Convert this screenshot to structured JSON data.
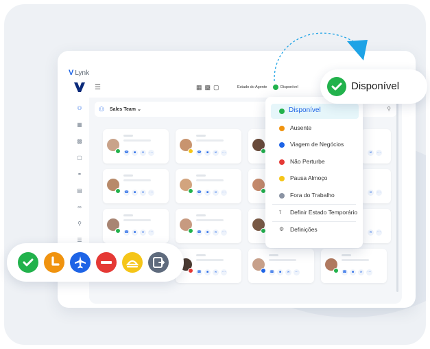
{
  "app": {
    "brand_mark": "V",
    "brand_name": "Lynk"
  },
  "topbar": {
    "agent_status_label": "Estado do Agente",
    "agent_status_value": "Disponível",
    "status_color": "#22b24c"
  },
  "team": {
    "name": "Sales Team"
  },
  "dropdown": {
    "items": [
      {
        "label": "Disponível",
        "color": "#22b24c",
        "icon": "check-icon",
        "active": true
      },
      {
        "label": "Ausente",
        "color": "#f0930f",
        "icon": "clock-icon"
      },
      {
        "label": "Viagem de Negócios",
        "color": "#1e64e6",
        "icon": "plane-icon"
      },
      {
        "label": "Não Perturbe",
        "color": "#e53935",
        "icon": "minus-icon"
      },
      {
        "label": "Pausa Almoço",
        "color": "#f5c518",
        "icon": "lunch-icon"
      },
      {
        "label": "Fora do Trabalho",
        "color": "#8a93a3",
        "icon": "exit-icon"
      }
    ],
    "actions": [
      {
        "label": "Definir Estado Temporário",
        "icon": "pin-icon"
      },
      {
        "label": "Definições",
        "icon": "gear-icon"
      }
    ]
  },
  "callout": {
    "label": "Disponível"
  },
  "status_bar": {
    "icons": [
      {
        "name": "available-status-icon",
        "color": "#22b24c"
      },
      {
        "name": "away-status-icon",
        "color": "#f0930f"
      },
      {
        "name": "business-trip-status-icon",
        "color": "#1e64e6"
      },
      {
        "name": "do-not-disturb-status-icon",
        "color": "#e53935"
      },
      {
        "name": "lunch-status-icon",
        "color": "#f5c518"
      },
      {
        "name": "off-work-status-icon",
        "color": "#5f6b7d"
      }
    ]
  }
}
